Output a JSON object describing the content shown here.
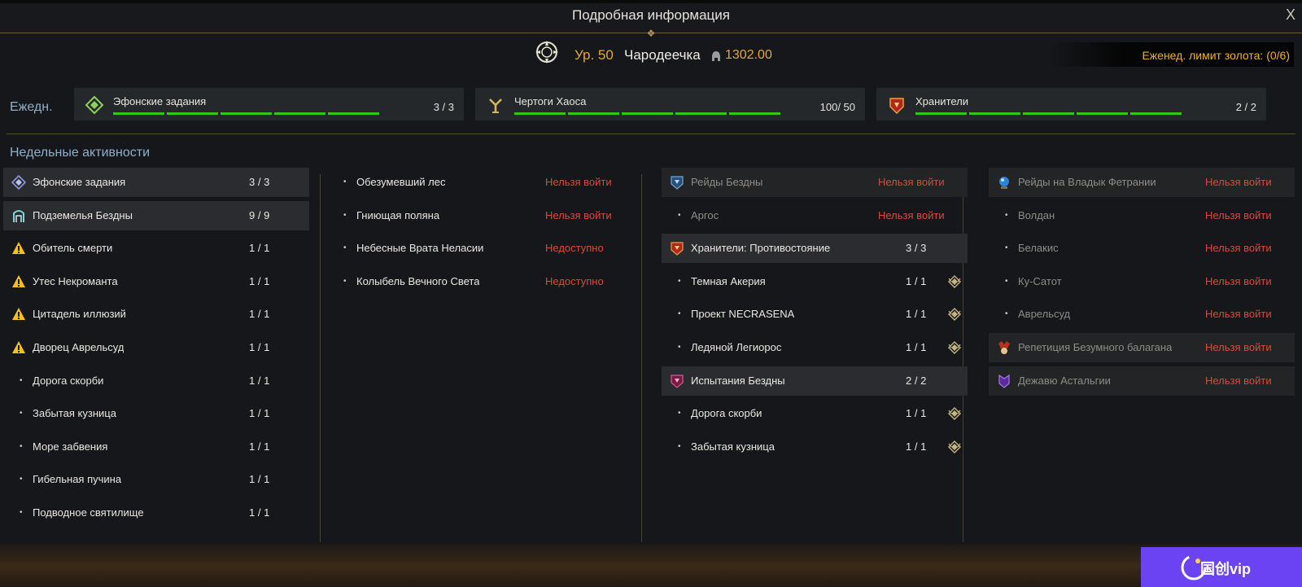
{
  "window": {
    "title": "Подробная информация",
    "close_label": "X"
  },
  "character": {
    "level": "Ур. 50",
    "class_name": "Чародеечка",
    "item_level": "1302.00"
  },
  "gold_limit": "Еженед. лимит золота: (0/6)",
  "daily": {
    "label": "Ежедн.",
    "cards": [
      {
        "name": "Эфонские задания",
        "count": "3  /  3",
        "icon": "chaos-dungeon-diamond-icon",
        "bars": 5
      },
      {
        "name": "Чертоги Хаоса",
        "count": "100/  50",
        "icon": "chaos-gate-icon",
        "bars": 5
      },
      {
        "name": "Хранители",
        "count": "2  /  2",
        "icon": "guardian-icon",
        "bars": 5
      }
    ]
  },
  "weekly": {
    "title": "Недельные активности",
    "col1": [
      {
        "name": "Эфонские задания",
        "count": "3  /  3",
        "icon": "quest-diamond-icon",
        "style": "hl"
      },
      {
        "name": "Подземелья Бездны",
        "count": "9  /  9",
        "icon": "abyss-gate-icon",
        "style": "hl"
      },
      {
        "name": "Обитель смерти",
        "count": "1  /  1",
        "icon": "warning-icon"
      },
      {
        "name": "Утес Некроманта",
        "count": "1  /  1",
        "icon": "warning-icon"
      },
      {
        "name": "Цитадель иллюзий",
        "count": "1  /  1",
        "icon": "warning-icon"
      },
      {
        "name": "Дворец Аврельсуд",
        "count": "1  /  1",
        "icon": "warning-icon"
      },
      {
        "name": "Дорога скорби",
        "count": "1  /  1",
        "icon": "bullet"
      },
      {
        "name": "Забытая кузница",
        "count": "1  /  1",
        "icon": "bullet"
      },
      {
        "name": "Море забвения",
        "count": "1  /  1",
        "icon": "bullet"
      },
      {
        "name": "Гибельная пучина",
        "count": "1  /  1",
        "icon": "bullet"
      },
      {
        "name": "Подводное святилище",
        "count": "1  /  1",
        "icon": "bullet"
      }
    ],
    "col2": [
      {
        "name": "Обезумевший лес",
        "status": "Нельзя войти"
      },
      {
        "name": "Гниющая поляна",
        "status": "Нельзя войти"
      },
      {
        "name": "Небесные Врата Неласии",
        "status": "Недоступно"
      },
      {
        "name": "Колыбель Вечного Света",
        "status": "Недоступно"
      }
    ],
    "col3": [
      {
        "name": "Рейды Бездны",
        "status": "Нельзя войти",
        "icon": "abyss-raid-icon",
        "style": "hl2",
        "dim": true
      },
      {
        "name": "Аргос",
        "status": "Нельзя войти",
        "icon": "bullet",
        "dim": true
      },
      {
        "name": "Хранители: Противостояние",
        "count": "3  /  3",
        "icon": "guardian-icon",
        "style": "hl"
      },
      {
        "name": "Темная Акерия",
        "count": "1  /  1",
        "icon": "bullet",
        "diamond": true
      },
      {
        "name": "Проект NECRASENA",
        "count": "1  /  1",
        "icon": "bullet",
        "diamond": true
      },
      {
        "name": "Ледяной Легиорос",
        "count": "1  /  1",
        "icon": "bullet",
        "diamond": true
      },
      {
        "name": "Испытания Бездны",
        "count": "2  /  2",
        "icon": "abyss-trial-icon",
        "style": "hl"
      },
      {
        "name": "Дорога скорби",
        "count": "1  /  1",
        "icon": "bullet",
        "diamond": true
      },
      {
        "name": "Забытая кузница",
        "count": "1  /  1",
        "icon": "bullet",
        "diamond": true
      }
    ],
    "col4": [
      {
        "name": "Рейды на Владык Фетрании",
        "status": "Нельзя войти",
        "icon": "blue-orb-icon",
        "style": "hl2",
        "dim": true
      },
      {
        "name": "Волдан",
        "status": "Нельзя войти",
        "icon": "bullet",
        "dim": true
      },
      {
        "name": "Белакис",
        "status": "Нельзя войти",
        "icon": "bullet",
        "dim": true
      },
      {
        "name": "Ку-Сатот",
        "status": "Нельзя войти",
        "icon": "bullet",
        "dim": true
      },
      {
        "name": "Аврельсуд",
        "status": "Нельзя войти",
        "icon": "bullet",
        "dim": true
      },
      {
        "name": "Репетиция Безумного балагана",
        "status": "Нельзя войти",
        "icon": "jester-icon",
        "style": "hl2",
        "dim": true
      },
      {
        "name": "Дежавю Астальгии",
        "status": "Нельзя войти",
        "icon": "dejavu-icon",
        "style": "hl2",
        "dim": true
      }
    ]
  },
  "watermark": {
    "text": "国创vip"
  },
  "colors": {
    "accent_gold": "#e3a935",
    "progress_green": "#35c515",
    "status_red": "#d94a3d",
    "section_blue": "#8fb0cc"
  }
}
